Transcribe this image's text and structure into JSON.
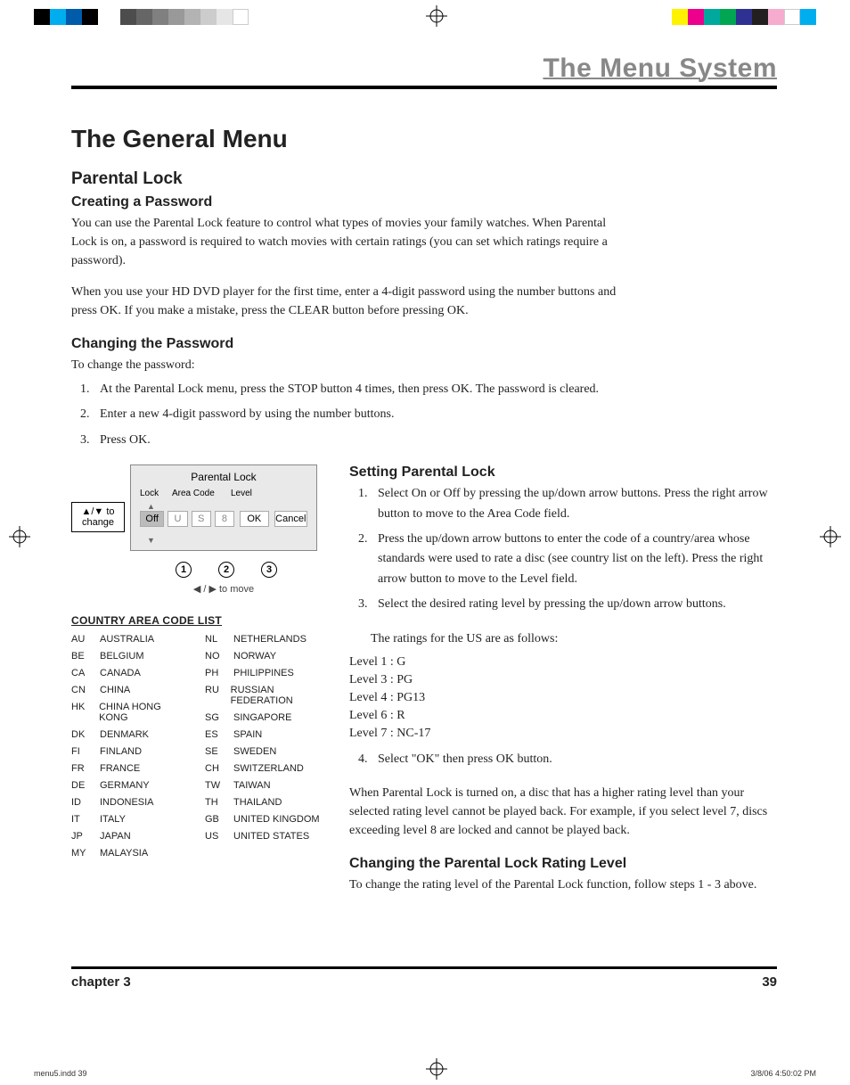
{
  "header": {
    "section_title": "The Menu System"
  },
  "title": "The General Menu",
  "parental": {
    "heading": "Parental Lock",
    "create": {
      "heading": "Creating a Password",
      "p1": "You can use the Parental Lock feature to control what types of movies your family watches. When Parental Lock is on, a password is required to watch movies with certain ratings (you can set which ratings require a password).",
      "p2": "When you use your HD DVD player for the first time, enter a 4-digit password using the number buttons and press OK. If you make a mistake, press the CLEAR button before pressing OK."
    },
    "change_pw": {
      "heading": "Changing the Password",
      "intro": "To change the password:",
      "steps": [
        "At the Parental Lock menu, press the STOP button 4 times, then press OK. The password is cleared.",
        "Enter a new 4-digit password by using the number buttons.",
        "Press OK."
      ]
    },
    "osd": {
      "title": "Parental Lock",
      "hint_up_down": "▲/▼ to change",
      "labels": {
        "lock": "Lock",
        "area": "Area Code",
        "level": "Level"
      },
      "values": {
        "lock": "Off",
        "area1": "U",
        "area2": "S",
        "level": "8",
        "ok": "OK",
        "cancel": "Cancel"
      },
      "markers": [
        "1",
        "2",
        "3"
      ],
      "move_hint": "◀ / ▶ to move"
    },
    "country_list": {
      "title": "COUNTRY AREA CODE LIST",
      "col1": [
        {
          "code": "AU",
          "name": "AUSTRALIA"
        },
        {
          "code": "BE",
          "name": "BELGIUM"
        },
        {
          "code": "CA",
          "name": "CANADA"
        },
        {
          "code": "CN",
          "name": "CHINA"
        },
        {
          "code": "HK",
          "name": "CHINA HONG KONG"
        },
        {
          "code": "DK",
          "name": "DENMARK"
        },
        {
          "code": "FI",
          "name": "FINLAND"
        },
        {
          "code": "FR",
          "name": "FRANCE"
        },
        {
          "code": "DE",
          "name": "GERMANY"
        },
        {
          "code": "ID",
          "name": "INDONESIA"
        },
        {
          "code": "IT",
          "name": "ITALY"
        },
        {
          "code": "JP",
          "name": "JAPAN"
        },
        {
          "code": "MY",
          "name": "MALAYSIA"
        }
      ],
      "col2": [
        {
          "code": "NL",
          "name": "NETHERLANDS"
        },
        {
          "code": "NO",
          "name": "NORWAY"
        },
        {
          "code": "PH",
          "name": "PHILIPPINES"
        },
        {
          "code": "RU",
          "name": "RUSSIAN FEDERATION"
        },
        {
          "code": "SG",
          "name": "SINGAPORE"
        },
        {
          "code": "ES",
          "name": "SPAIN"
        },
        {
          "code": "SE",
          "name": "SWEDEN"
        },
        {
          "code": "CH",
          "name": "SWITZERLAND"
        },
        {
          "code": "TW",
          "name": "TAIWAN"
        },
        {
          "code": "TH",
          "name": "THAILAND"
        },
        {
          "code": "GB",
          "name": "UNITED KINGDOM"
        },
        {
          "code": "US",
          "name": "UNITED STATES"
        }
      ]
    },
    "setting": {
      "heading": "Setting Parental Lock",
      "steps": [
        "Select On or Off by pressing the up/down arrow buttons. Press the right arrow button to move to the Area Code field.",
        "Press the up/down arrow buttons to enter the code of a country/area whose standards were used to rate a disc (see country list on the left). Press the right arrow button to move to the Level field.",
        "Select the desired rating level by pressing the up/down arrow buttons."
      ],
      "ratings_intro": "The ratings for the US are as follows:",
      "ratings": [
        " Level 1 : G",
        "Level 3 : PG",
        "Level 4 : PG13",
        "Level 6 : R",
        "Level 7 : NC-17"
      ],
      "step4": "Select \"OK\" then press OK button.",
      "after": "When Parental Lock is turned on, a disc that has a higher rating level than your selected rating level cannot be played back. For example, if you select level 7, discs exceeding level 8 are locked and cannot be played back."
    },
    "change_level": {
      "heading": "Changing the Parental Lock Rating Level",
      "p": "To change the rating level of the Parental Lock function, follow steps 1 - 3 above."
    }
  },
  "footer": {
    "chapter": "chapter 3",
    "page": "39"
  },
  "printfoot": {
    "file": "menu5.indd   39",
    "ts": "3/8/06   4:50:02 PM"
  },
  "colors": {
    "left_bar": [
      "#000000",
      "#00aeef",
      "#005baa",
      "#000000"
    ],
    "right_bar": [
      "#fff200",
      "#ec008c",
      "#00a99d",
      "#00a651",
      "#2e3192",
      "#231f20",
      "#f6adcd",
      "#ffffff",
      "#00aeef"
    ],
    "grey_steps": [
      "#4d4d4d",
      "#666666",
      "#808080",
      "#999999",
      "#b3b3b3",
      "#cccccc",
      "#e6e6e6",
      "#ffffff"
    ]
  }
}
